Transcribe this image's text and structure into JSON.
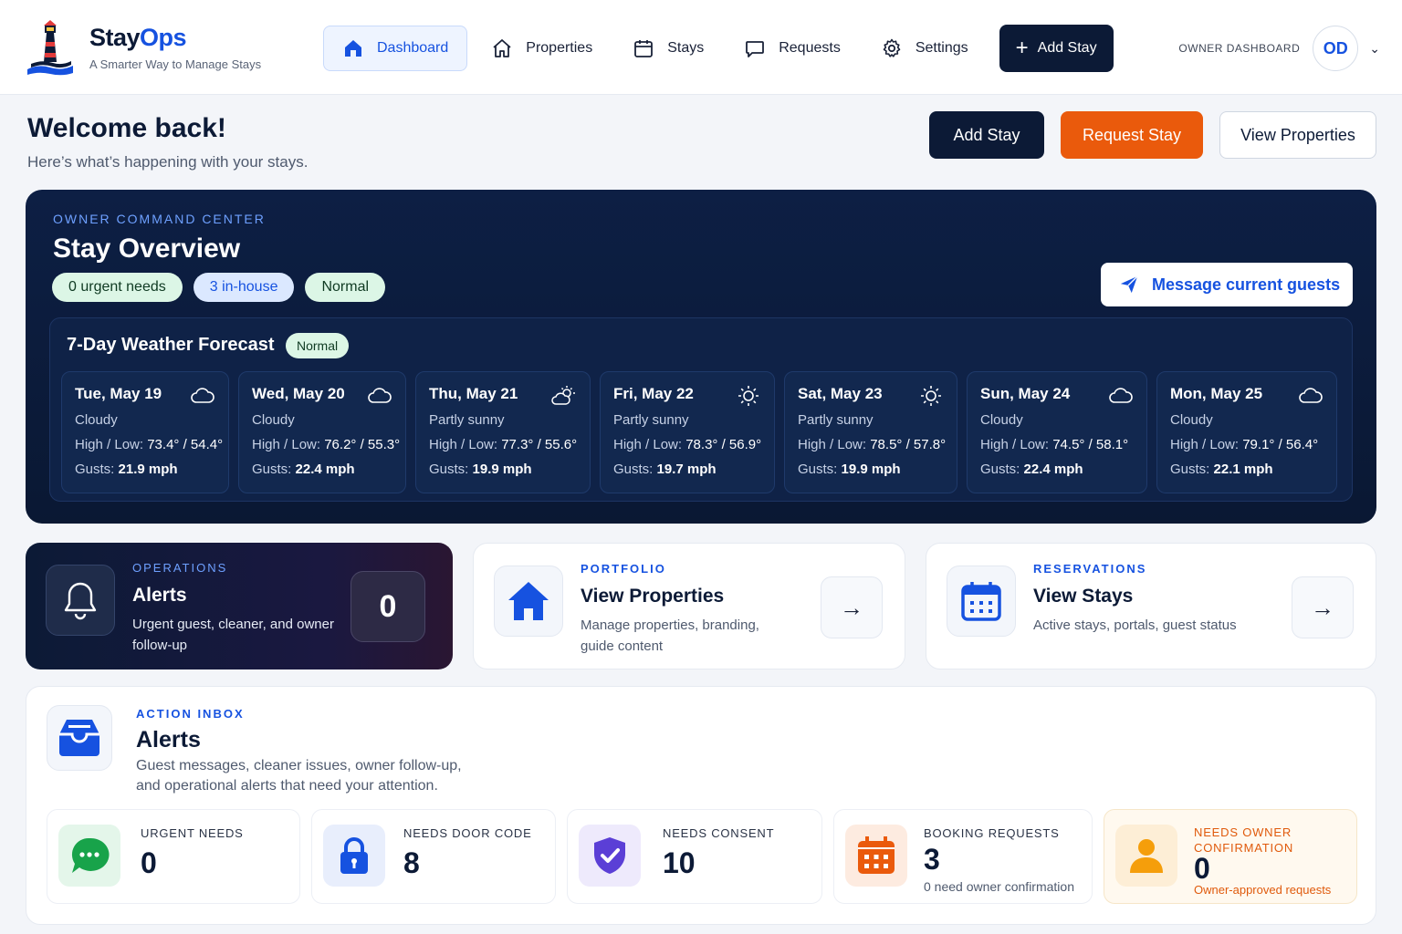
{
  "brand": {
    "name_a": "Stay",
    "name_b": "Ops",
    "tagline": "A Smarter Way to Manage Stays"
  },
  "nav": {
    "items": [
      {
        "label": "Dashboard",
        "icon": "home-icon",
        "active": true
      },
      {
        "label": "Properties",
        "icon": "house-outline-icon"
      },
      {
        "label": "Stays",
        "icon": "calendar-icon"
      },
      {
        "label": "Requests",
        "icon": "chat-bubble-icon"
      },
      {
        "label": "Settings",
        "icon": "gear-icon"
      }
    ],
    "add_label": "Add Stay"
  },
  "owner": {
    "label": "OWNER DASHBOARD",
    "initials": "OD"
  },
  "welcome": {
    "title": "Welcome back!",
    "subtitle": "Here’s what’s happening with your stays.",
    "actions": {
      "add": "Add Stay",
      "request": "Request Stay",
      "view": "View Properties"
    }
  },
  "command_center": {
    "eyebrow": "OWNER COMMAND CENTER",
    "title": "Stay Overview",
    "pills": [
      "0 urgent needs",
      "3 in-house",
      "Normal"
    ],
    "message_button": "Message current guests"
  },
  "weather": {
    "title": "7-Day Weather Forecast",
    "badge": "Normal",
    "hl_label": "High / Low:",
    "gust_label": "Gusts:",
    "days": [
      {
        "name": "Tue, May 19",
        "cond": "Cloudy",
        "hl": "73.4° / 54.4°",
        "gust": "21.9 mph",
        "icon": "cloud-icon"
      },
      {
        "name": "Wed, May 20",
        "cond": "Cloudy",
        "hl": "76.2° / 55.3°",
        "gust": "22.4 mph",
        "icon": "cloud-icon"
      },
      {
        "name": "Thu, May 21",
        "cond": "Partly sunny",
        "hl": "77.3° / 55.6°",
        "gust": "19.9 mph",
        "icon": "partly-sunny-icon"
      },
      {
        "name": "Fri, May 22",
        "cond": "Partly sunny",
        "hl": "78.3° / 56.9°",
        "gust": "19.7 mph",
        "icon": "sun-icon"
      },
      {
        "name": "Sat, May 23",
        "cond": "Partly sunny",
        "hl": "78.5° / 57.8°",
        "gust": "19.9 mph",
        "icon": "sun-icon"
      },
      {
        "name": "Sun, May 24",
        "cond": "Cloudy",
        "hl": "74.5° / 58.1°",
        "gust": "22.4 mph",
        "icon": "cloud-icon"
      },
      {
        "name": "Mon, May 25",
        "cond": "Cloudy",
        "hl": "79.1° / 56.4°",
        "gust": "22.1 mph",
        "icon": "cloud-icon"
      }
    ]
  },
  "cards": {
    "ops": {
      "eyebrow": "OPERATIONS",
      "title": "Alerts",
      "desc": "Urgent guest, cleaner, and owner follow-up",
      "count": "0"
    },
    "portfolio": {
      "eyebrow": "PORTFOLIO",
      "title": "View Properties",
      "desc": "Manage properties, branding, guide content"
    },
    "reservations": {
      "eyebrow": "RESERVATIONS",
      "title": "View Stays",
      "desc": "Active stays, portals, guest status"
    }
  },
  "inbox": {
    "eyebrow": "ACTION INBOX",
    "title": "Alerts",
    "desc": "Guest messages, cleaner issues, owner follow-up, and operational alerts that need your attention.",
    "stats": [
      {
        "label": "URGENT NEEDS",
        "value": "0",
        "sub": "",
        "icon": "chat-dots-icon"
      },
      {
        "label": "NEEDS DOOR CODE",
        "value": "8",
        "sub": "",
        "icon": "lock-icon"
      },
      {
        "label": "NEEDS CONSENT",
        "value": "10",
        "sub": "",
        "icon": "shield-check-icon"
      },
      {
        "label": "BOOKING REQUESTS",
        "value": "3",
        "sub": "0 need owner confirmation",
        "icon": "calendar-grid-icon"
      },
      {
        "label": "NEEDS OWNER CONFIRMATION",
        "value": "0",
        "sub": "Owner-approved requests",
        "icon": "user-icon"
      }
    ]
  },
  "colors": {
    "accent": "#1652e0",
    "navy": "#0c1a36",
    "orange": "#ea5a0c"
  }
}
